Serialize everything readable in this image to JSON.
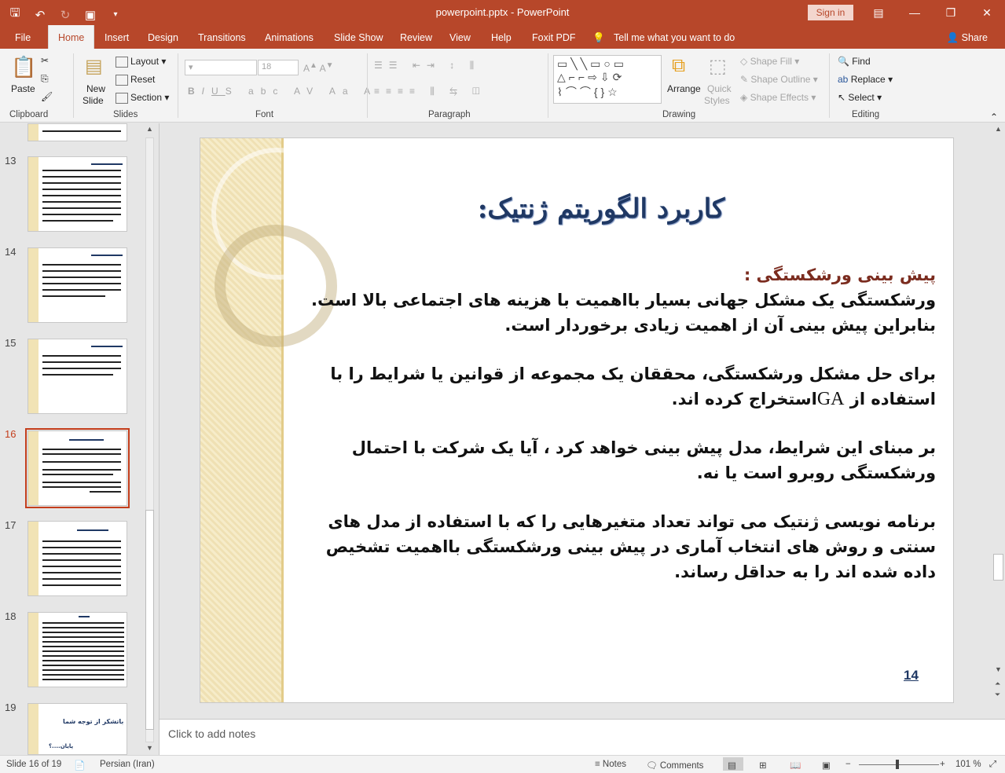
{
  "window": {
    "title": "powerpoint.pptx  -  PowerPoint",
    "sign_in": "Sign in"
  },
  "tabs": [
    "File",
    "Home",
    "Insert",
    "Design",
    "Transitions",
    "Animations",
    "Slide Show",
    "Review",
    "View",
    "Help",
    "Foxit PDF"
  ],
  "tell_me": "Tell me what you want to do",
  "share": "Share",
  "ribbon": {
    "clipboard": {
      "label": "Clipboard",
      "paste": "Paste"
    },
    "slides": {
      "label": "Slides",
      "new_slide_1": "New",
      "new_slide_2": "Slide",
      "layout": "Layout",
      "reset": "Reset",
      "section": "Section"
    },
    "font": {
      "label": "Font",
      "size": "18"
    },
    "paragraph": {
      "label": "Paragraph"
    },
    "drawing": {
      "label": "Drawing",
      "arrange": "Arrange",
      "quick_styles_1": "Quick",
      "quick_styles_2": "Styles",
      "shape_fill": "Shape Fill",
      "shape_outline": "Shape Outline",
      "shape_effects": "Shape Effects"
    },
    "editing": {
      "label": "Editing",
      "find": "Find",
      "replace": "Replace",
      "select": "Select"
    }
  },
  "thumbnails": [
    {
      "num": "13"
    },
    {
      "num": "14"
    },
    {
      "num": "15"
    },
    {
      "num": "16"
    },
    {
      "num": "17"
    },
    {
      "num": "18"
    },
    {
      "num": "19",
      "title": "باتشکر از توجه شما",
      "sub": "پایان....؟"
    }
  ],
  "slide": {
    "title": "کاربرد الگوریتم ژنتیک:",
    "heading": "پیش بینی ورشکستگی :",
    "para1": "ورشکستگی یک مشکل جهانی بسیار بااهمیت با هزینه های اجتماعی بالا است. بنابراین پیش بینی آن از اهمیت زیادی برخوردار است.",
    "para2a": "برای حل مشکل ورشکستگی، محققان یک مجموعه از قوانین یا شرایط را با استفاده از",
    "para2_ga": "GA",
    "para2b": "استخراج کرده اند.",
    "para3": "بر مبنای این شرایط، مدل پیش بینی خواهد کرد ، آیا یک شرکت با احتمال ورشکستگی روبرو است یا نه.",
    "para4": "برنامه نویسی ژنتیک می تواند تعداد متغیرهایی را که با استفاده از مدل های سنتی و روش های انتخاب آماری در پیش بینی ورشکستگی بااهمیت تشخیص داده شده اند را به حداقل رساند.",
    "number": "14"
  },
  "notes_placeholder": "Click to add notes",
  "status": {
    "slide_info": "Slide 16 of 19",
    "language": "Persian (Iran)",
    "notes": "Notes",
    "comments": "Comments",
    "zoom": "101 %"
  }
}
